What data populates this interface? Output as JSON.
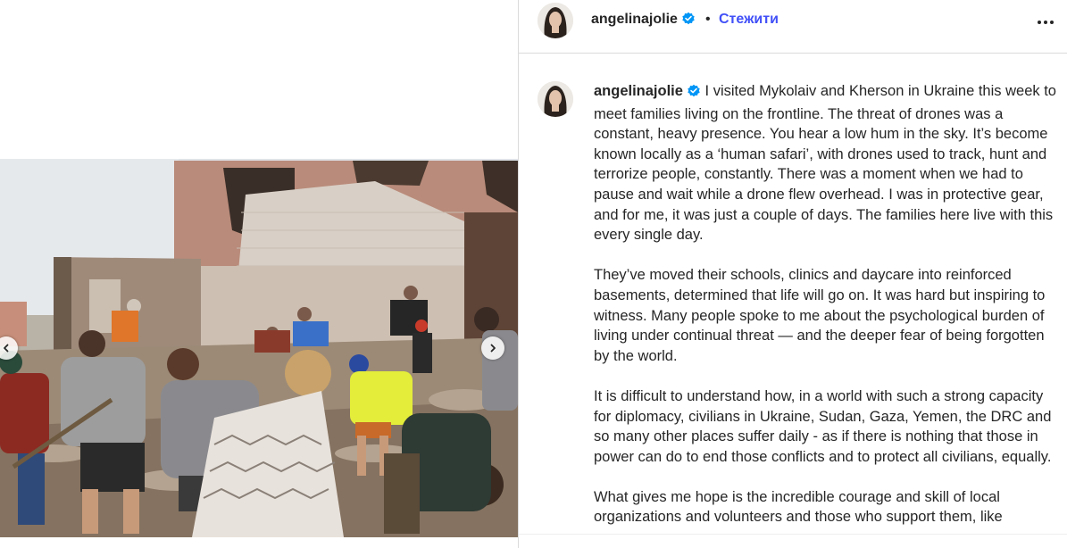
{
  "post": {
    "username": "angelinajolie",
    "dot": "•",
    "follow_label": "Стежити",
    "more_label": "•••"
  },
  "caption": {
    "username": "angelinajolie",
    "paragraphs": [
      "I visited Mykolaiv and Kherson in Ukraine this week to meet families living on the frontline. The threat of drones was a constant, heavy presence. You hear a low hum in the sky. It’s become known locally as a ‘human safari’, with drones used to track, hunt and terrorize people, constantly. There was a moment when we had to pause and wait while a drone flew overhead. I was in protective gear, and for me, it was just a couple of days. The families here live with this every single day.",
      "They’ve moved their schools, clinics and daycare into reinforced basements, determined that life will go on. It was hard but inspiring to witness. Many people spoke to me about the psychological burden of living under continual threat — and the deeper fear of being forgotten by the world.",
      "It is difficult to understand how, in a world with such a strong capacity for diplomacy, civilians in Ukraine, Sudan, Gaza, Yemen, the DRC and so many other places suffer daily - as if there is nothing that those in power can do to end those conflicts and to protect all civilians, equally.",
      "What gives me hope is the incredible courage and skill of local organizations and volunteers and those who support them, like"
    ]
  },
  "icons": {
    "verified": "verified-badge-icon",
    "prev": "chevron-left-icon",
    "next": "chevron-right-icon",
    "more": "more-options-icon"
  },
  "colors": {
    "follow": "#4150f7",
    "verified": "#0095f6",
    "text": "#262626",
    "border": "#dbdbdb"
  }
}
